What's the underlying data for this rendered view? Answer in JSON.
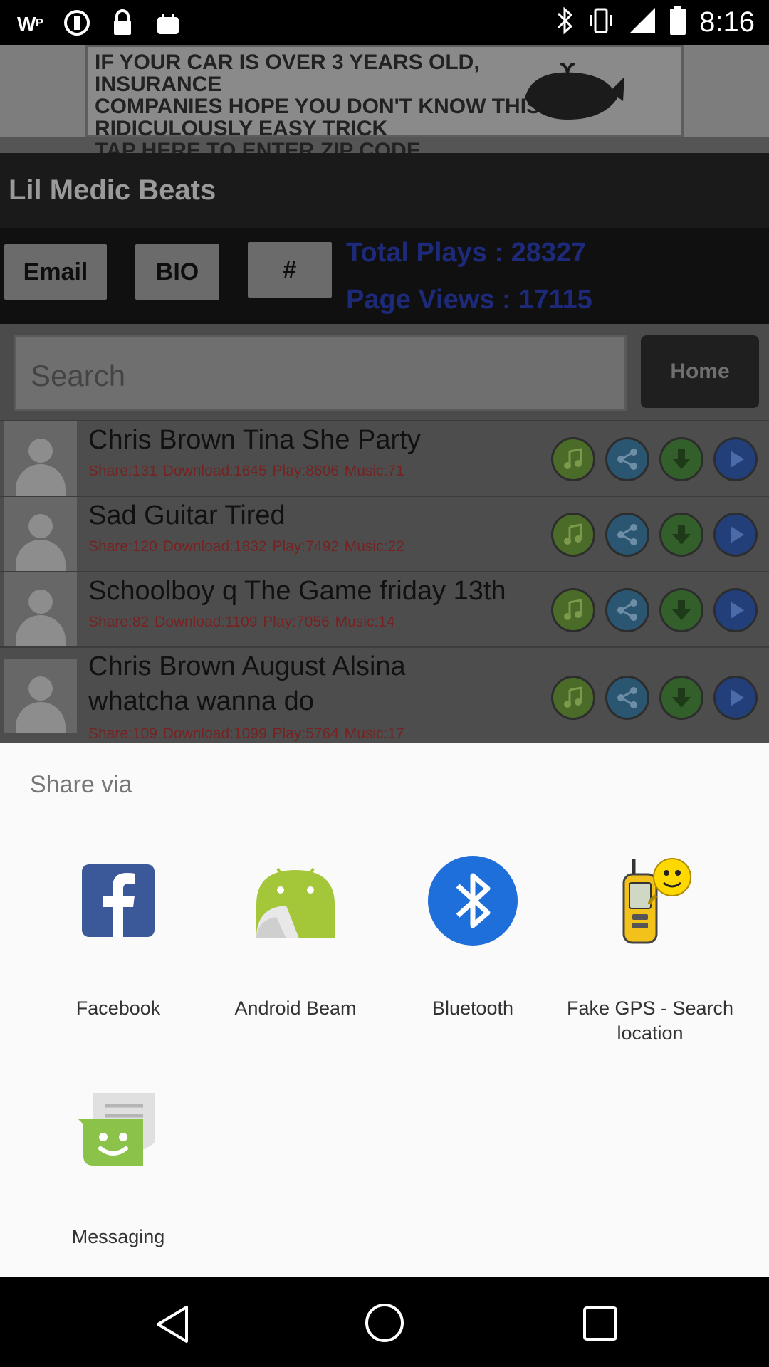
{
  "status_bar": {
    "time": "8:16"
  },
  "ad": {
    "line1": "IF YOUR CAR IS OVER 3 YEARS OLD, INSURANCE",
    "line2": "COMPANIES HOPE YOU DON'T KNOW THIS",
    "line3": "RIDICULOUSLY EASY TRICK",
    "line4": "TAP HERE TO ENTER ZIP CODE"
  },
  "app": {
    "title": "Lil Medic Beats",
    "buttons": {
      "email": "Email",
      "bio": "BIO",
      "hash": "#"
    },
    "total_plays": "Total Plays : 28327",
    "page_views": "Page Views : 17115",
    "search_placeholder": "Search",
    "home_label": "Home",
    "songs": [
      {
        "title": "Chris Brown Tina She Party",
        "meta": "Share:131  Download:1645  Play:8606  Music:71"
      },
      {
        "title": "Sad Guitar Tired",
        "meta": "Share:120  Download:1832  Play:7492  Music:22"
      },
      {
        "title": "Schoolboy q The Game friday 13th",
        "meta": "Share:82  Download:1109  Play:7056  Music:14"
      },
      {
        "title_line1": "Chris Brown August Alsina",
        "title_line2": "whatcha wanna do",
        "meta": "Share:109  Download:1099  Play:5764  Music:17"
      }
    ]
  },
  "share_sheet": {
    "title": "Share via",
    "options": [
      {
        "label": "Facebook",
        "icon": "facebook-icon"
      },
      {
        "label": "Android Beam",
        "icon": "android-beam-icon"
      },
      {
        "label": "Bluetooth",
        "icon": "bluetooth-icon"
      },
      {
        "label_line1": "Fake GPS - Search",
        "label_line2": "location",
        "icon": "fake-gps-icon"
      },
      {
        "label": "Messaging",
        "icon": "messaging-icon"
      }
    ]
  },
  "colors": {
    "facebook": "#3b5998",
    "android": "#a4c639",
    "bluetooth": "#1e6fd9",
    "messaging": "#8bc34a"
  }
}
